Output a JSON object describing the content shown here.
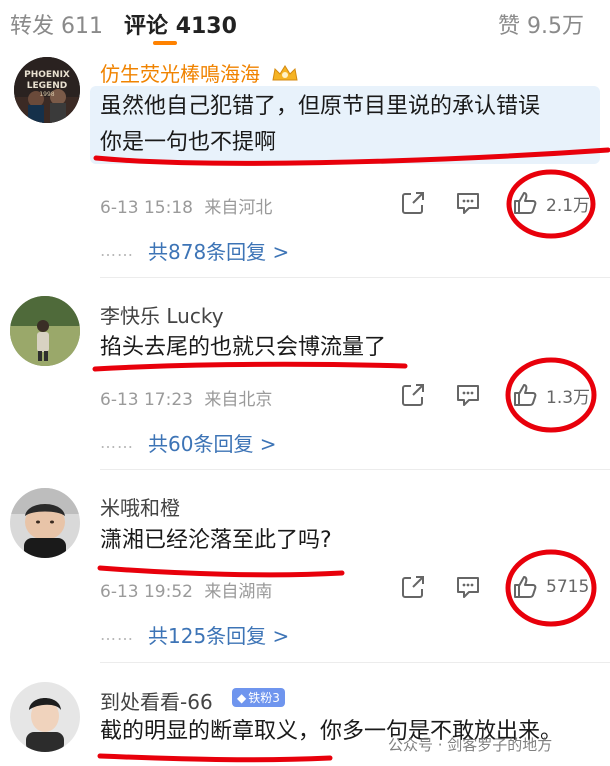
{
  "tabs": {
    "repost_label": "转发",
    "repost_count": "611",
    "comments_label": "评论",
    "comments_count": "4130",
    "likes_label": "赞",
    "likes_count": "9.5万"
  },
  "comments": [
    {
      "username": "仿生荧光棒鳴海海",
      "avatar_text": "PHOENIX LEGEND 1998",
      "text_line1": "虽然他自己犯错了，但原节目里说的承认错误",
      "text_line2": "你是一句也不提啊",
      "date": "6-13 15:18",
      "location": "来自河北",
      "likes": "2.1万",
      "replies_text": "共878条回复 >"
    },
    {
      "username": "李快乐 Lucky",
      "text_line1": "掐头去尾的也就只会博流量了",
      "date": "6-13 17:23",
      "location": "来自北京",
      "likes": "1.3万",
      "replies_text": "共60条回复 >"
    },
    {
      "username": "米哦和橙",
      "text_line1": "潇湘已经沦落至此了吗?",
      "date": "6-13 19:52",
      "location": "来自湖南",
      "likes": "5715",
      "replies_text": "共125条回复 >"
    },
    {
      "username": "到处看看-66",
      "badge": "铁粉3",
      "text_line1": "截的明显的断章取义，你多一句是不敢放出来。"
    }
  ],
  "watermark": "公众号 · 剑客罗子的地方",
  "replies_dots": "……",
  "colors": {
    "accent": "#ff8200",
    "link": "#3d74b6",
    "annotation_red": "#e8000b",
    "username_highlight": "#f08300"
  }
}
